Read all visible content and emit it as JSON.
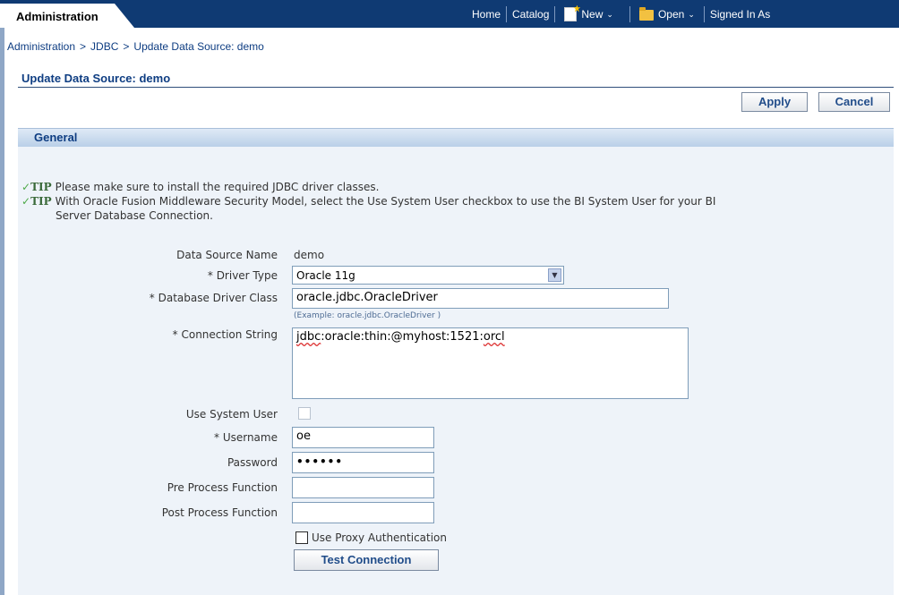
{
  "topbar": {
    "admin_tab": "Administration",
    "nav": {
      "home": "Home",
      "catalog": "Catalog",
      "new": "New",
      "open": "Open",
      "signed_in": "Signed In As"
    }
  },
  "breadcrumb": {
    "items": [
      "Administration",
      "JDBC"
    ],
    "current": "Update Data Source: demo",
    "separator": ">"
  },
  "page": {
    "title": "Update Data Source: demo",
    "apply_label": "Apply",
    "cancel_label": "Cancel"
  },
  "section": {
    "title": "General",
    "tip_label": "TIP",
    "tips": [
      "Please make sure to install the required JDBC driver classes.",
      "With Oracle Fusion Middleware Security Model, select the Use System User checkbox to use the BI System User for your BI",
      "Server Database Connection."
    ]
  },
  "form": {
    "labels": {
      "data_source_name": "Data Source Name",
      "driver_type": "* Driver Type",
      "driver_class": "* Database Driver Class",
      "connection_string": "* Connection String",
      "use_system_user": "Use System User",
      "username": "* Username",
      "password": "Password",
      "pre_process": "Pre Process Function",
      "post_process": "Post Process Function"
    },
    "values": {
      "data_source_name": "demo",
      "driver_type": "Oracle 11g",
      "driver_class": "oracle.jdbc.OracleDriver",
      "driver_class_hint": "(Example: oracle.jdbc.OracleDriver )",
      "connection_string_a": "jdbc",
      "connection_string_b": ":oracle:thin:@myhost:1521:",
      "connection_string_c": "orcl",
      "use_system_user": false,
      "username": "oe",
      "password": "••••••",
      "pre_process": "",
      "post_process": ""
    },
    "use_proxy_label": "Use Proxy Authentication",
    "use_proxy_checked": false,
    "test_connection_label": "Test Connection"
  }
}
